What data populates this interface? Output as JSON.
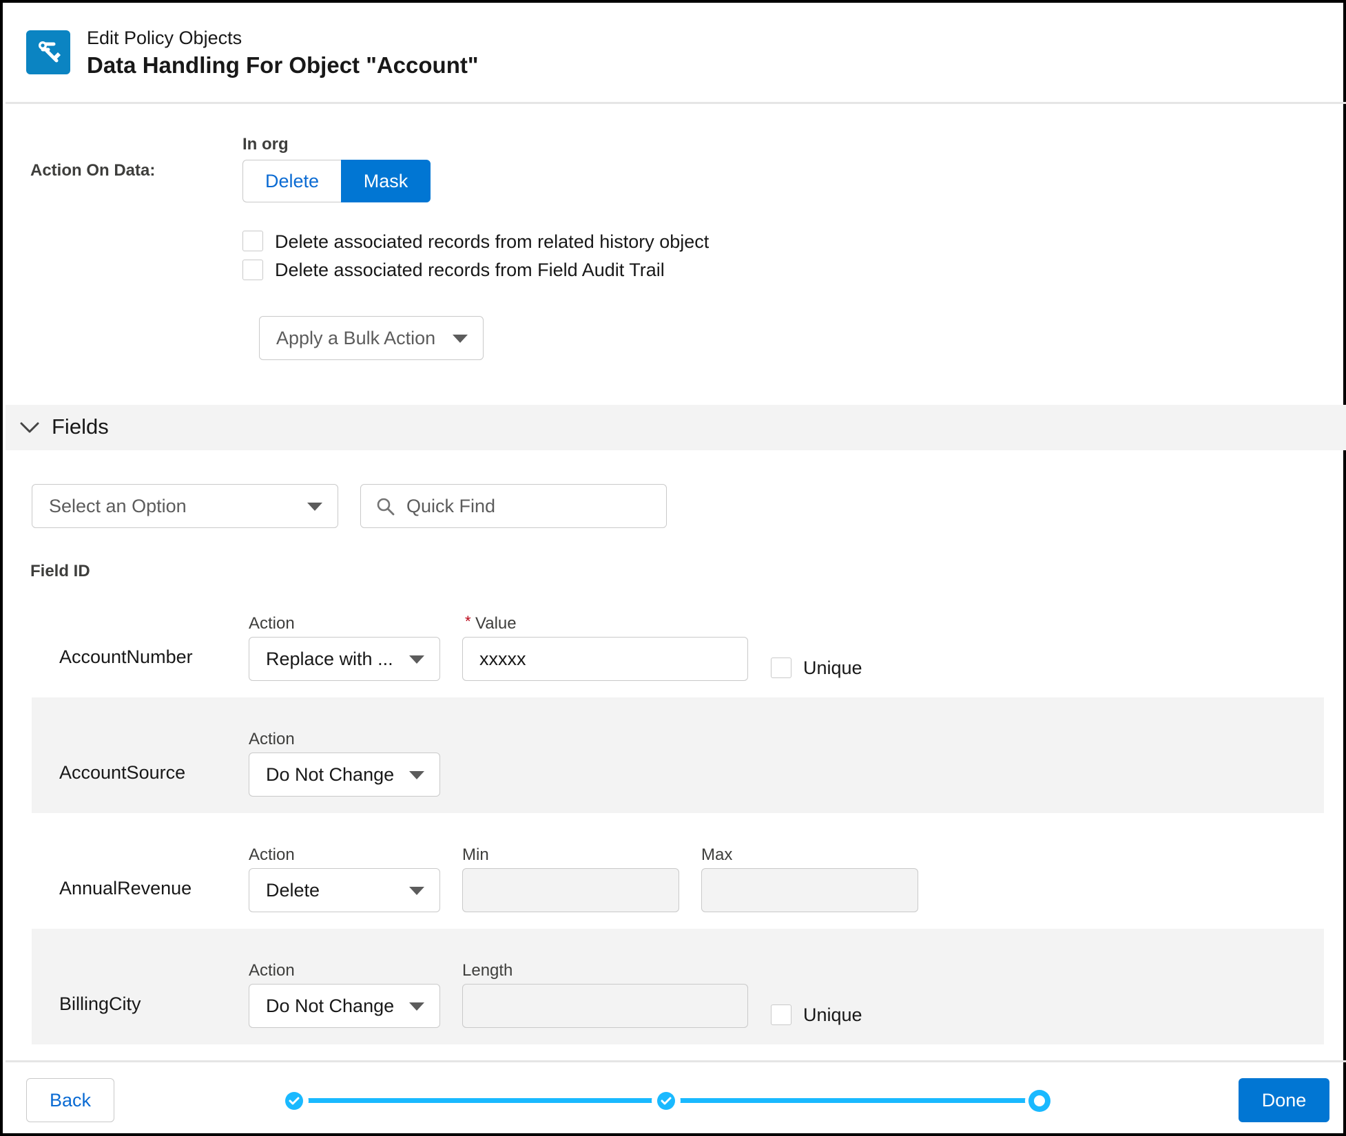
{
  "header": {
    "subtitle": "Edit Policy Objects",
    "title": "Data Handling For Object \"Account\"",
    "icon": "wrench-icon"
  },
  "action_on_data": {
    "label": "Action On Data:",
    "scope_label": "In org",
    "options": [
      "Delete",
      "Mask"
    ],
    "selected": "Mask",
    "checkboxes": [
      {
        "label": "Delete associated records from related history object",
        "checked": false
      },
      {
        "label": "Delete associated records from Field Audit Trail",
        "checked": false
      }
    ],
    "bulk_action_placeholder": "Apply a Bulk Action"
  },
  "fields_section": {
    "title": "Fields",
    "filter_placeholder": "Select an Option",
    "search_placeholder": "Quick Find",
    "column_label": "Field ID",
    "rows": [
      {
        "name": "AccountNumber",
        "action_label": "Action",
        "action": "Replace with ...",
        "value_label": "Value",
        "value": "xxxxx",
        "unique_label": "Unique",
        "unique": false
      },
      {
        "name": "AccountSource",
        "action_label": "Action",
        "action": "Do Not Change"
      },
      {
        "name": "AnnualRevenue",
        "action_label": "Action",
        "action": "Delete",
        "min_label": "Min",
        "min": "",
        "max_label": "Max",
        "max": ""
      },
      {
        "name": "BillingCity",
        "action_label": "Action",
        "action": "Do Not Change",
        "length_label": "Length",
        "length": "",
        "unique_label": "Unique",
        "unique": false
      }
    ]
  },
  "footer": {
    "back_label": "Back",
    "done_label": "Done",
    "progress": {
      "steps": 3,
      "completed": 2,
      "current": 3
    }
  },
  "colors": {
    "brand": "#0176d3",
    "icon_bg": "#0b84c2",
    "progress": "#1ab9ff",
    "required": "#ba0517"
  }
}
